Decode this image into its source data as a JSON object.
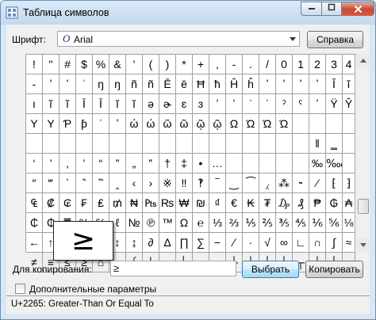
{
  "window": {
    "title": "Таблица символов"
  },
  "font": {
    "label": "Шрифт:",
    "selected": "Arial",
    "icon": "O"
  },
  "help_button": "Справка",
  "grid": {
    "rows": [
      [
        "!",
        "\"",
        "#",
        "$",
        "%",
        "&",
        "'",
        "(",
        ")",
        "*",
        "+",
        ",",
        "-",
        ".",
        "/",
        "0",
        "1",
        "2",
        "3",
        "4"
      ],
      [
        "-",
        "ʼ",
        "ʽ",
        "ʾ",
        "ŋ",
        "ŋ",
        "ñ",
        "ñ",
        "Ē",
        "ē",
        "Ħ",
        "ħ",
        "Ĥ",
        "ĥ",
        "ʼ",
        "ʽ",
        "ʼ",
        "ʽ",
        "Ĭ",
        "ĭ"
      ],
      [
        "ı",
        "ĩ",
        "ĩ",
        "Ī",
        "Ī",
        "ĭ",
        "ĭ",
        "ə",
        "ɚ",
        "ɛ",
        "ɜ",
        "ʼ",
        "ʽ",
        "ʾ",
        "ʿ",
        "ˀ",
        "ˁ",
        "ʽ",
        "Ÿ",
        "Ŷ"
      ],
      [
        "Y",
        "Y",
        "Ƥ",
        "ƥ",
        "ʿ",
        "ʽ",
        "ώ",
        "ώ",
        "ῶ",
        "ῶ",
        "ῷ",
        "ῷ",
        "Ω",
        "Ώ",
        "Ώ",
        "Ώ",
        "",
        "",
        "",
        ""
      ],
      [
        "",
        "",
        "",
        "",
        "",
        "",
        "",
        "",
        "",
        "",
        "",
        "",
        "",
        "",
        "",
        "",
        "",
        "‖",
        "‗",
        ""
      ],
      [
        "‘",
        "’",
        "‚",
        "‛",
        "“",
        "”",
        "„",
        "‟",
        "†",
        "‡",
        "•",
        "…",
        "",
        "",
        "",
        "",
        "",
        "‰",
        "‱",
        ""
      ],
      [
        "″",
        "‴",
        "‵",
        "‶",
        "‷",
        "‸",
        "‹",
        "›",
        "※",
        "‼",
        "‽",
        "‾",
        "‿",
        "⁀",
        "⁁",
        "⁂",
        "⁃",
        "⁄",
        "⁅",
        "⁆"
      ],
      [
        "₠",
        "₡",
        "₢",
        "₣",
        "₤",
        "₥",
        "₦",
        "₧",
        "₨",
        "₩",
        "₪",
        "₫",
        "€",
        "₭",
        "₮",
        "₯",
        "₰",
        "₱",
        "₲",
        "₳"
      ],
      [
        "₵",
        "₵",
        "₸",
        "%",
        "℅",
        "ℓ",
        "№",
        "℗",
        "™",
        "Ω",
        "℮",
        "⅓",
        "⅔",
        "⅕",
        "⅖",
        "⅗",
        "⅘",
        "⅙",
        "⅚",
        "⅛"
      ],
      [
        "←",
        "↑",
        "→",
        "↓",
        "↔",
        "↕",
        "↨",
        "∂",
        "∆",
        "∏",
        "∑",
        "−",
        "∕",
        "∙",
        "√",
        "∞",
        "∟",
        "∩",
        "∫",
        "≈"
      ],
      [
        "≠",
        "≡",
        "≤",
        "≥",
        "⌂",
        "⌐",
        "⌠",
        "⌡",
        "─",
        "│",
        "┌",
        "┐",
        "└",
        "┘",
        "├",
        "┤",
        "┬",
        "┴",
        "┼",
        "═"
      ]
    ]
  },
  "magnifier": {
    "char": "≥"
  },
  "copy": {
    "label": "Для копирования:",
    "value": "≥"
  },
  "select_button": "Выбрать",
  "copy_button": "Копировать",
  "advanced": {
    "label": "Дополнительные параметры"
  },
  "status": "U+2265: Greater-Than Or Equal To",
  "colors": {
    "title_bar": "#c4d8ef",
    "close_button": "#c7493a",
    "window_bg": "#f0f0f0"
  }
}
